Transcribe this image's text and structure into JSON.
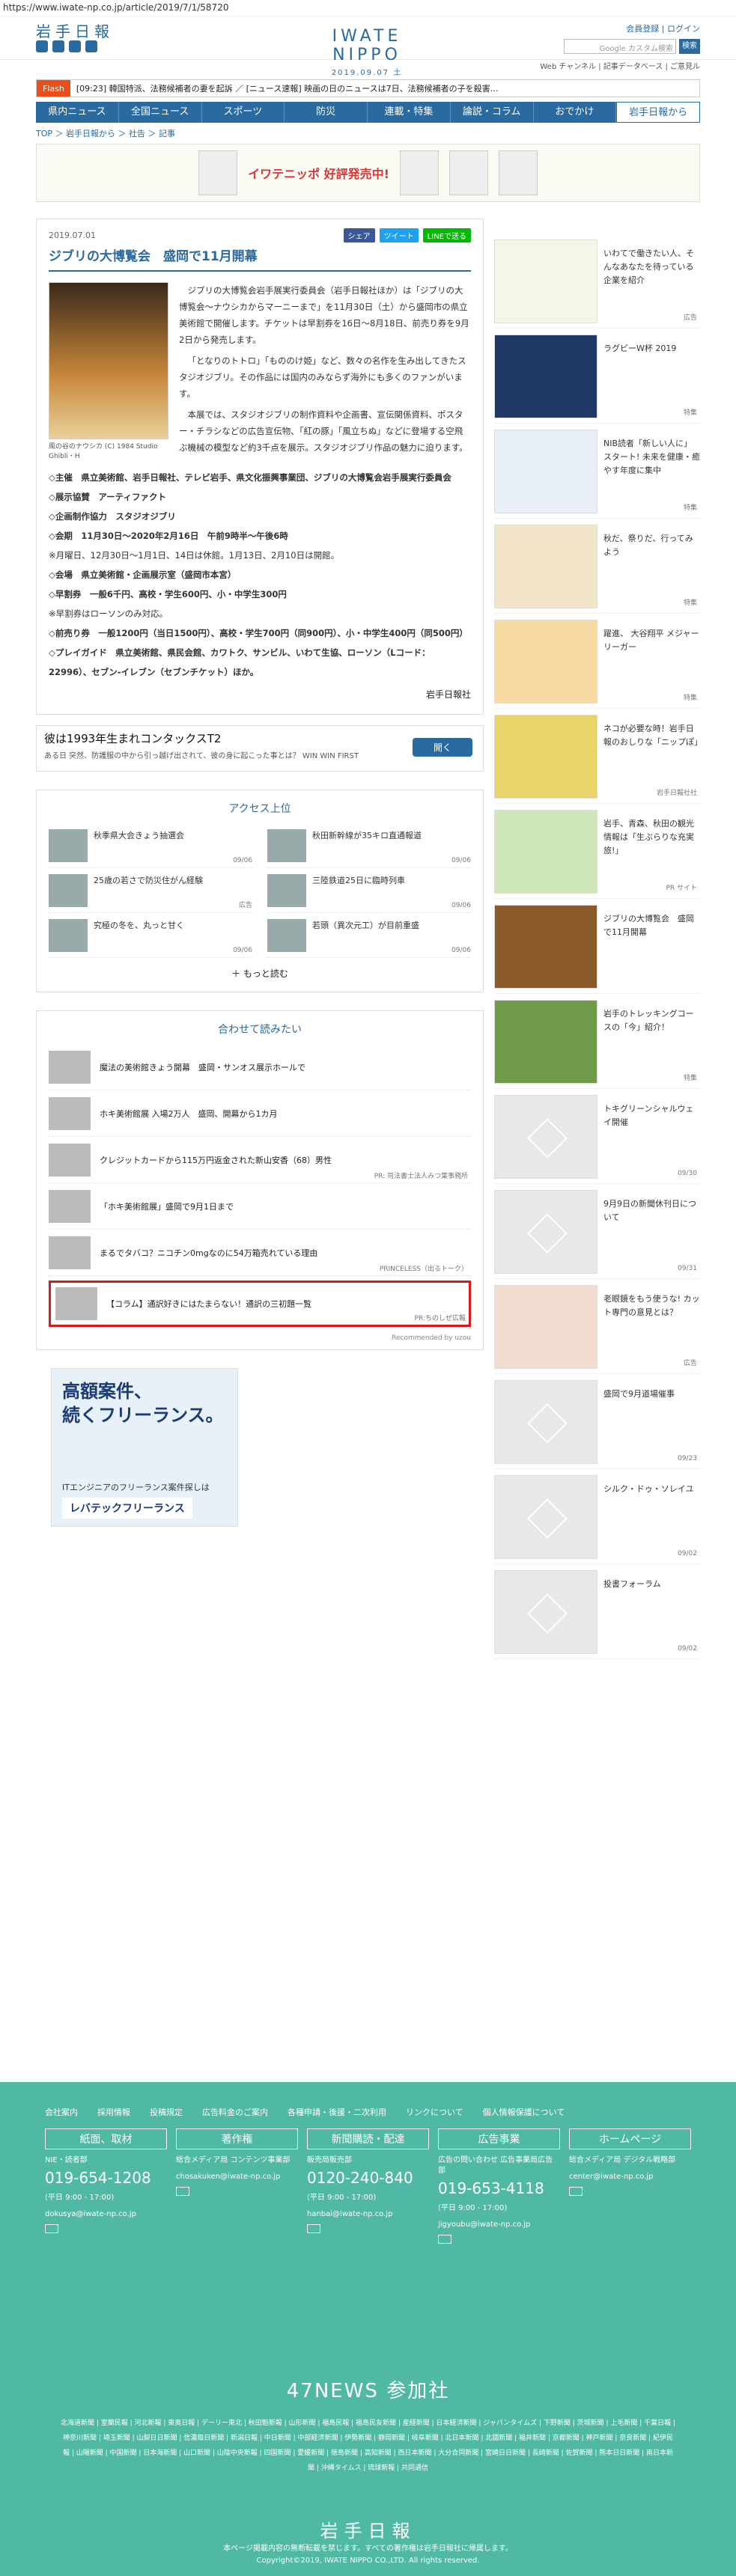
{
  "url": "https://www.iwate-np.co.jp/article/2019/7/1/58720",
  "header": {
    "logo": "岩手日報",
    "center_title": "IWATE NIPPO",
    "date": "2019.09.07 土",
    "top_links": "会員登録 | ログイン",
    "search_placeholder": "Google カスタム検索",
    "search_button": "検索",
    "subnav": "Web チャンネル | 記事データベース | ご意見ル"
  },
  "flash": {
    "label": "Flash",
    "text": "[09:23] 韓国特派、法務候補者の妻を起訴 ／ [ニュース速報] 映画の日のニュースは7日、法務候補者の子を殺害…"
  },
  "nav": {
    "items": [
      "県内ニュース",
      "全国ニュース",
      "スポーツ",
      "防災",
      "連載・特集",
      "論説・コラム",
      "おでかけ",
      "岩手日報から"
    ]
  },
  "breadcrumb": "TOP ＞ 岩手日報から ＞ 社告 ＞ 記事",
  "banner": {
    "text": "イワテニッポ 好評発売中!"
  },
  "article": {
    "date": "2019.07.01",
    "share": [
      "シェア",
      "ツイート",
      "LINEで送る"
    ],
    "title": "ジブリの大博覧会　盛岡で11月開幕",
    "image_caption": "風の谷のナウシカ (C) 1984 Studio Ghibli・H",
    "paragraphs": [
      "ジブリの大博覧会岩手展実行委員会（岩手日報社ほか）は「ジブリの大博覧会～ナウシカからマーニーまで」を11月30日（土）から盛岡市の県立美術館で開催します。チケットは早割券を16日～8月18日、前売り券を9月2日から発売します。",
      "「となりのトトロ」「もののけ姫」など、数々の名作を生み出してきたスタジオジブリ。その作品には国内のみならず海外にも多くのファンがいます。",
      "本展では、スタジオジブリの制作資料や企画書、宣伝関係資料、ポスター・チラシなどの広告宣伝物、「紅の豚」「風立ちぬ」などに登場する空飛ぶ機械の模型など約3千点を展示。スタジオジブリ作品の魅力に迫ります。"
    ],
    "info": [
      "◇主催　県立美術館、岩手日報社、テレビ岩手、県文化振興事業団、ジブリの大博覧会岩手展実行委員会",
      "◇展示協賛　アーティファクト",
      "◇企画制作協力　スタジオジブリ",
      "◇会期　11月30日～2020年2月16日　午前9時半～午後6時",
      "※月曜日、12月30日～1月1日、14日は休館。1月13日、2月10日は開館。",
      "◇会場　県立美術館・企画展示室（盛岡市本宮）",
      "◇早割券　一般6千円、高校・学生600円、小・中学生300円",
      "※早割券はローソンのみ対応。",
      "◇前売り券　一般1200円（当日1500円）、高校・学生700円（同900円）、小・中学生400円（同500円）",
      "◇プレイガイド　県立美術館、県民会館、カワトク、サンビル、いわて生協、ローソン（Lコード：22996）、セブン-イレブン（セブンチケット）ほか。"
    ],
    "signature": "岩手日報社"
  },
  "ad_strip": {
    "title": "彼は1993年生まれコンタックスT2",
    "sub": "ある日 突然、防護服の中から引っ越げ出されて、彼の身に起こった事とは？ WIN WIN FIRST",
    "button": "開く"
  },
  "ranking": {
    "title": "アクセス上位",
    "items": [
      {
        "title": "秋季県大会きょう抽選会",
        "date": "09/06"
      },
      {
        "title": "秋田新幹線が35キロ直通報道",
        "date": "09/06"
      },
      {
        "title": "25歳の若さで防災住がん経験",
        "date": "広告"
      },
      {
        "title": "三陸鉄道25日に臨時列車",
        "date": "09/06"
      },
      {
        "title": "究極の冬を、丸っと甘く",
        "date": "09/06"
      },
      {
        "title": "若頭（異次元工）が目前重盛",
        "date": "09/06"
      }
    ],
    "more": "もっと読む"
  },
  "recommend": {
    "title": "合わせて読みたい",
    "items": [
      {
        "title": "魔法の美術館きょう開幕　盛岡・サンオス展示ホールで",
        "pr": ""
      },
      {
        "title": "ホキ美術館展 入場2万人　盛岡、開幕から1カ月",
        "pr": ""
      },
      {
        "title": "クレジットカードから115万円返金された新山安香（68）男性",
        "pr": "PR: 司法書士法人みつ葉事務所"
      },
      {
        "title": "「ホキ美術館展」盛岡で9月1日まで",
        "pr": ""
      },
      {
        "title": "まるでタバコ？ニコチン0mgなのに54万箱売れている理由",
        "pr": "PRINCELESS（出るトーク）"
      },
      {
        "title": "【コラム】通訳好きにはたまらない！通訳の三初題一覧",
        "pr": "PR:ちのしぜ広報"
      }
    ],
    "powered": "Recommended by uzou"
  },
  "bottom_ad": {
    "line1": "高額案件、",
    "line2": "続くフリーランス。",
    "sub": "ITエンジニアのフリーランス案件探しは",
    "brand": "レバテックフリーランス"
  },
  "sidebar": {
    "items": [
      {
        "title": "いわてで働きたい人、そんなあなたを待っている企業を紹介",
        "date": "広告"
      },
      {
        "title": "ラグビーW杯 2019",
        "date": "特集"
      },
      {
        "title": "NIB読者「新しい人に」スタート! 未来を健康・癒やす年度に集中",
        "date": "特集"
      },
      {
        "title": "秋だ、祭りだ、行ってみよう",
        "date": "特集"
      },
      {
        "title": "躍進、 大谷翔平 メジャーリーガー",
        "date": "特集"
      },
      {
        "title": "ネコが必要な時！岩手日報のおしりな「ニップぽ」",
        "date": "岩手日報社社"
      },
      {
        "title": "岩手、青森、秋田の観光情報は「生ぶらりな充実旅!」",
        "date": "PR サイト"
      },
      {
        "title": "ジブリの大博覧会　盛岡で11月開幕",
        "date": ""
      },
      {
        "title": "岩手のトレッキングコースの「今」紹介！",
        "date": "特集"
      },
      {
        "title": "トキグリーンシャルウェイ開催",
        "date": "09/30"
      },
      {
        "title": "9月9日の新聞休刊日について",
        "date": "09/31"
      },
      {
        "title": "老眼鏡をもう使うな! カット専門の意見とは？",
        "date": "広告"
      },
      {
        "title": "盛岡で9月道場催事",
        "date": "09/23"
      },
      {
        "title": "シルク・ドゥ・ソレイユ",
        "date": "09/02"
      },
      {
        "title": "投書フォーラム",
        "date": "09/02"
      }
    ]
  },
  "footer": {
    "links": [
      "会社案内",
      "採用情報",
      "投稿規定",
      "広告料金のご案内",
      "各種申請・後援・二次利用",
      "リンクについて",
      "個人情報保護について"
    ],
    "columns": [
      {
        "head": "紙面、取材",
        "sub": "NIE・読者部",
        "phone": "019-654-1208",
        "hours": "(平日 9:00 - 17:00)",
        "mail": "dokusya@iwate-np.co.jp"
      },
      {
        "head": "著作権",
        "sub": "総合メディア局 コンテンツ事業部",
        "phone": "",
        "hours": "",
        "mail": "chosakuken@iwate-np.co.jp"
      },
      {
        "head": "新聞購読・配達",
        "sub": "販売局販売部",
        "phone": "0120-240-840",
        "hours": "(平日 9:00 - 17:00)",
        "mail": "hanbai@iwate-np.co.jp"
      },
      {
        "head": "広告事業",
        "sub": "広告の問い合わせ 広告事業局広告部",
        "phone": "019-653-4118",
        "hours": "(平日 9:00 - 17:00)",
        "mail": "jigyoubu@iwate-np.co.jp"
      },
      {
        "head": "ホームページ",
        "sub": "総合メディア局 デジタル戦略部",
        "phone": "",
        "hours": "",
        "mail": "center@iwate-np.co.jp"
      }
    ],
    "section_47": "47NEWS 参加社",
    "papers": "北海道新聞 | 室蘭民報 | 河北新報 | 東奥日報 | デーリー東北 | 秋田魁新報 | 山形新聞 | 福島民報 | 福島民友新聞 | 産経新聞 | 日本経済新聞 | ジャパンタイムズ | 下野新聞 | 茨城新聞 | 上毛新聞 | 千葉日報 | 神奈川新聞 | 埼玉新聞 | 山梨日日新聞 | 信濃毎日新聞 | 新潟日報 | 中日新聞 | 中部経済新聞 | 伊勢新聞 | 静岡新聞 | 岐阜新聞 | 北日本新聞 | 北國新聞 | 福井新聞 | 京都新聞 | 神戸新聞 | 奈良新聞 | 紀伊民報 | 山陽新聞 | 中国新聞 | 日本海新聞 | 山口新聞 | 山陰中央新報 | 四国新聞 | 愛媛新聞 | 徳島新聞 | 高知新聞 | 西日本新聞 | 大分合同新聞 | 宮崎日日新聞 | 長崎新聞 | 佐賀新聞 | 熊本日日新聞 | 南日本新聞 | 沖縄タイムス | 琉球新報 | 共同通信",
    "logo": "岩手日報",
    "copy1": "本ページ掲載内容の無断転載を禁じます。すべての著作権は岩手日報社に帰属します。",
    "copy2": "Copyright©2019, IWATE NIPPO CO.,LTD. All rights reserved."
  }
}
